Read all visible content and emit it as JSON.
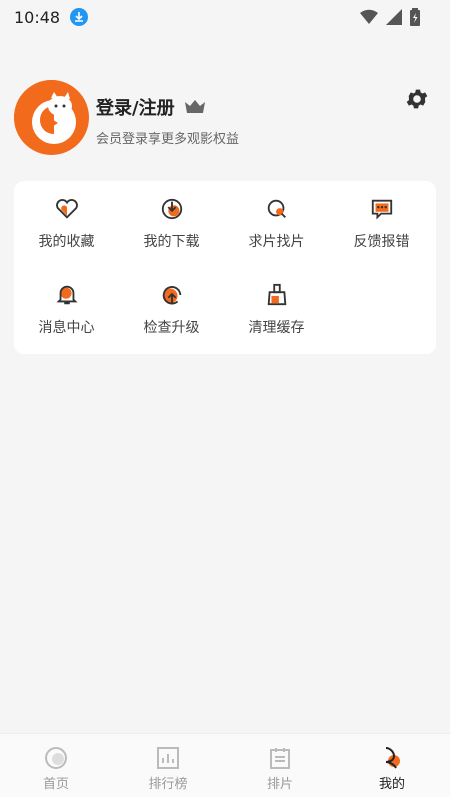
{
  "status": {
    "time": "10:48"
  },
  "profile": {
    "title": "登录/注册",
    "subtitle": "会员登录享更多观影权益"
  },
  "menu": [
    {
      "label": "我的收藏",
      "icon": "heart-icon"
    },
    {
      "label": "我的下载",
      "icon": "download-icon"
    },
    {
      "label": "求片找片",
      "icon": "search-film-icon"
    },
    {
      "label": "反馈报错",
      "icon": "feedback-icon"
    },
    {
      "label": "消息中心",
      "icon": "bell-icon"
    },
    {
      "label": "检查升级",
      "icon": "upgrade-icon"
    },
    {
      "label": "清理缓存",
      "icon": "broom-icon"
    }
  ],
  "tabs": [
    {
      "label": "首页",
      "icon": "home-icon"
    },
    {
      "label": "排行榜",
      "icon": "ranking-icon"
    },
    {
      "label": "排片",
      "icon": "schedule-icon"
    },
    {
      "label": "我的",
      "icon": "profile-icon"
    }
  ],
  "colors": {
    "accent": "#f26a1b",
    "background": "#f5f5f5",
    "card": "#ffffff"
  }
}
